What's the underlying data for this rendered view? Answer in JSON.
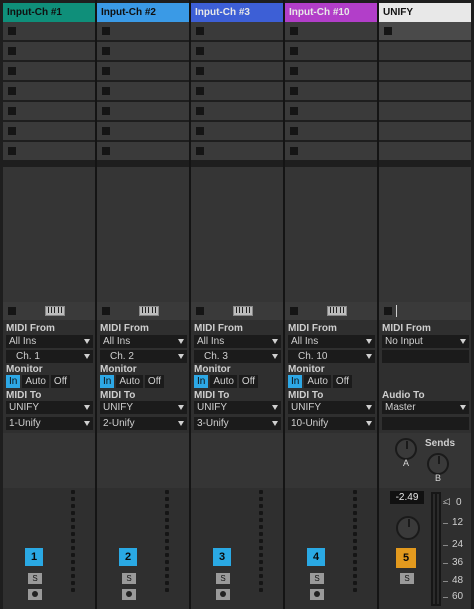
{
  "tracks": [
    {
      "name": "Input-Ch #1",
      "color": "#0f8f7a",
      "midi_from_label": "MIDI From",
      "midi_from": "All Ins",
      "channel": "Ch. 1",
      "monitor_label": "Monitor",
      "monitor": [
        "In",
        "Auto",
        "Off"
      ],
      "midi_to_label": "MIDI To",
      "midi_to": "UNIFY",
      "midi_to_ch": "1-Unify",
      "number": "1",
      "solo": "S"
    },
    {
      "name": "Input-Ch #2",
      "color": "#3a9ae6",
      "midi_from_label": "MIDI From",
      "midi_from": "All Ins",
      "channel": "Ch. 2",
      "monitor_label": "Monitor",
      "monitor": [
        "In",
        "Auto",
        "Off"
      ],
      "midi_to_label": "MIDI To",
      "midi_to": "UNIFY",
      "midi_to_ch": "2-Unify",
      "number": "2",
      "solo": "S"
    },
    {
      "name": "Input-Ch #3",
      "color": "#3d5fd6",
      "midi_from_label": "MIDI From",
      "midi_from": "All Ins",
      "channel": "Ch. 3",
      "monitor_label": "Monitor",
      "monitor": [
        "In",
        "Auto",
        "Off"
      ],
      "midi_to_label": "MIDI To",
      "midi_to": "UNIFY",
      "midi_to_ch": "3-Unify",
      "number": "3",
      "solo": "S"
    },
    {
      "name": "Input-Ch #10",
      "color": "#b23ec9",
      "midi_from_label": "MIDI From",
      "midi_from": "All Ins",
      "channel": "Ch. 10",
      "monitor_label": "Monitor",
      "monitor": [
        "In",
        "Auto",
        "Off"
      ],
      "midi_to_label": "MIDI To",
      "midi_to": "UNIFY",
      "midi_to_ch": "10-Unify",
      "number": "4",
      "solo": "S"
    }
  ],
  "unify": {
    "name": "UNIFY",
    "color": "#e8e8e8",
    "midi_from_label": "MIDI From",
    "midi_from": "No Input",
    "audio_to_label": "Audio To",
    "audio_to": "Master",
    "sends_label": "Sends",
    "send_a": "A",
    "send_b": "B",
    "volume": "-2.49",
    "number": "5",
    "number_color": "#e39a1e",
    "solo": "S",
    "scale": [
      "0",
      "12",
      "24",
      "36",
      "48",
      "60"
    ]
  }
}
